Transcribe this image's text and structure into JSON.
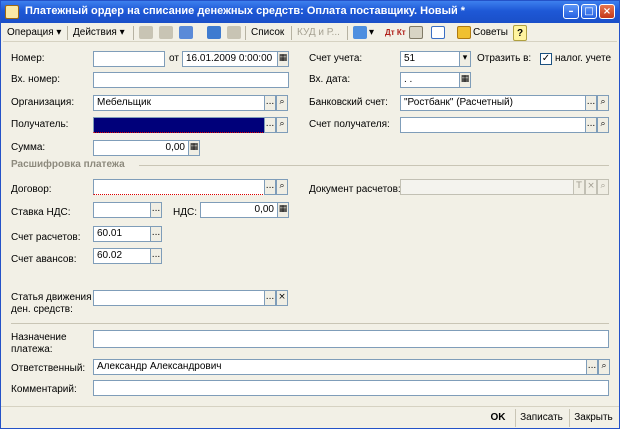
{
  "window": {
    "title": "Платежный ордер на списание денежных средств: Оплата поставщику. Новый *"
  },
  "toolbar": {
    "operation": "Операция",
    "actions": "Действия",
    "list": "Список",
    "kud": "КУД и Р...",
    "tips": "Советы",
    "help": "?",
    "dt_kt": "Дт Кт"
  },
  "form": {
    "number": {
      "label": "Номер:",
      "value": ""
    },
    "date": {
      "label": "от",
      "value": "16.01.2009  0:00:00"
    },
    "account": {
      "label": "Счет учета:",
      "value": "51"
    },
    "reflect": {
      "label": "Отразить в:",
      "checked": true,
      "check_label": "налог. учете"
    },
    "in_number": {
      "label": "Вх. номер:",
      "value": ""
    },
    "in_date": {
      "label": "Вх. дата:",
      "value": " .  .    "
    },
    "organization": {
      "label": "Организация:",
      "value": "Мебельщик"
    },
    "bank_account": {
      "label": "Банковский счет:",
      "value": "\"Ростбанк\" (Расчетный)"
    },
    "recipient": {
      "label": "Получатель:",
      "value": ""
    },
    "recipient_account": {
      "label": "Счет получателя:",
      "value": ""
    },
    "sum": {
      "label": "Сумма:",
      "value": "0,00"
    },
    "section_title": "Расшифровка платежа",
    "contract": {
      "label": "Договор:",
      "value": ""
    },
    "settlement_doc": {
      "label": "Документ расчетов:",
      "value": ""
    },
    "vat_rate": {
      "label": "Ставка НДС:",
      "value": ""
    },
    "vat": {
      "label": "НДС:",
      "value": "0,00"
    },
    "settlement_acc": {
      "label": "Счет расчетов:",
      "value": "60.01"
    },
    "advance_acc": {
      "label": "Счет авансов:",
      "value": "60.02"
    },
    "cashflow_item": {
      "label_line1": "Статья движения",
      "label_line2": "ден. средств:",
      "value": ""
    },
    "purpose": {
      "label_line1": "Назначение",
      "label_line2": "платежа:",
      "value": ""
    },
    "responsible": {
      "label": "Ответственный:",
      "value": "Александр Александрович"
    },
    "comment": {
      "label": "Комментарий:",
      "value": ""
    }
  },
  "buttons": {
    "ok": "OK",
    "save": "Записать",
    "close": "Закрыть"
  },
  "glyphs": {
    "ellipsis": "...",
    "search": "⌕",
    "clear": "×",
    "dropdown": "▾",
    "calendar": "▦",
    "calc": "▦",
    "check": "✓",
    "t": "T"
  }
}
